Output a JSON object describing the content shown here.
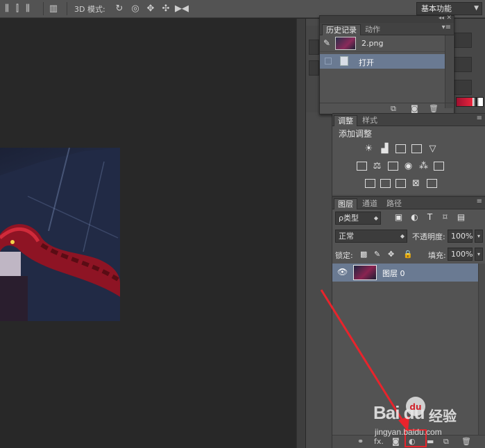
{
  "options_bar": {
    "mode_3d_label": "3D 模式:",
    "workspace": "基本功能"
  },
  "history_panel": {
    "tabs": [
      "历史记录",
      "动作"
    ],
    "snapshot_name": "2.png",
    "states": [
      {
        "label": "打开",
        "selected": true
      }
    ]
  },
  "adjustments_panel": {
    "tabs": [
      "调整",
      "样式"
    ],
    "title": "添加调整"
  },
  "layers_panel": {
    "tabs": [
      "图层",
      "通道",
      "路径"
    ],
    "filter_kind": "ρ类型",
    "blend_mode": "正常",
    "opacity_label": "不透明度:",
    "opacity_value": "100%",
    "lock_label": "锁定:",
    "fill_label": "填充:",
    "fill_value": "100%",
    "layers": [
      {
        "name": "图层 0",
        "visible": true,
        "selected": true
      }
    ]
  },
  "watermark": {
    "brand": "Bai du",
    "paw_text": "du",
    "cn": "经验",
    "url": "jingyan.baidu.com"
  },
  "colors": {
    "selection": "#6a7a92",
    "annotation": "#e8242c",
    "panel_bg": "#535353"
  }
}
